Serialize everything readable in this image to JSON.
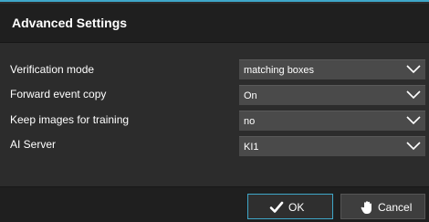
{
  "dialog": {
    "title": "Advanced Settings",
    "accent_color": "#3fa7c9"
  },
  "settings": [
    {
      "label": "Verification mode",
      "value": "matching boxes",
      "icon": "chevron-down-icon"
    },
    {
      "label": "Forward event copy",
      "value": "On",
      "icon": "chevron-down-icon"
    },
    {
      "label": "Keep images for training",
      "value": "no",
      "icon": "chevron-down-icon"
    },
    {
      "label": "AI Server",
      "value": "KI1",
      "icon": "chevron-down-icon"
    }
  ],
  "footer": {
    "ok_label": "OK",
    "ok_icon": "checkmark-icon",
    "cancel_label": "Cancel",
    "cancel_icon": "hand-stop-icon"
  }
}
